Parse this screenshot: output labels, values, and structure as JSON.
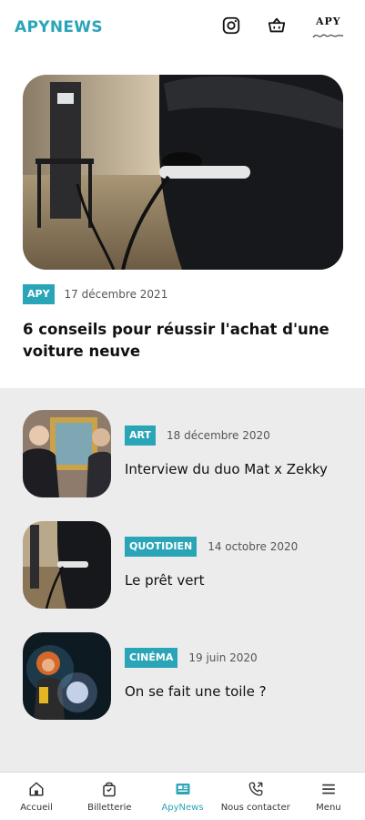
{
  "header": {
    "brand": "APYNEWS",
    "icons": [
      "instagram-icon",
      "basket-icon",
      "apy-logo"
    ],
    "logo_text": "APY"
  },
  "featured": {
    "tag": "APY",
    "date": "17 décembre 2021",
    "title": "6 conseils pour réussir l'achat d'une voiture neuve"
  },
  "articles": [
    {
      "tag": "ART",
      "date": "18 décembre 2020",
      "title": "Interview du duo Mat x Zekky"
    },
    {
      "tag": "QUOTIDIEN",
      "date": "14 octobre 2020",
      "title": "Le prêt vert"
    },
    {
      "tag": "CINÉMA",
      "date": "19 juin 2020",
      "title": "On se fait une toile ?"
    }
  ],
  "nav": {
    "items": [
      {
        "label": "Accueil",
        "icon": "home-icon"
      },
      {
        "label": "Billetterie",
        "icon": "ticket-bag-icon"
      },
      {
        "label": "ApyNews",
        "icon": "news-icon"
      },
      {
        "label": "Nous contacter",
        "icon": "phone-icon"
      },
      {
        "label": "Menu",
        "icon": "menu-icon"
      }
    ],
    "active": "ApyNews"
  },
  "colors": {
    "accent": "#2aa5b8",
    "background": "#ececec"
  }
}
